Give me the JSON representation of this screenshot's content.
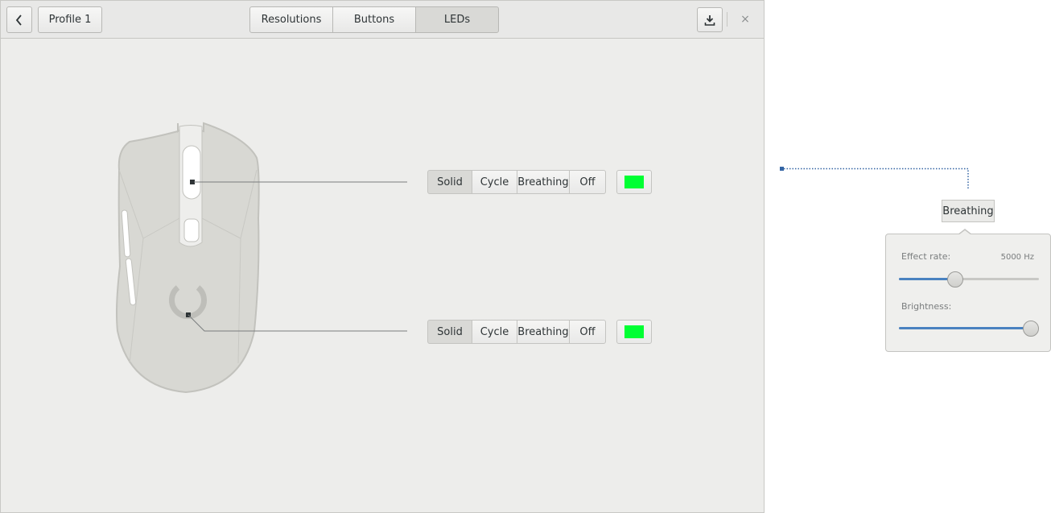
{
  "header": {
    "back_icon": "chevron-left-icon",
    "profile_label": "Profile 1",
    "tabs": [
      {
        "label": "Resolutions",
        "active": false
      },
      {
        "label": "Buttons",
        "active": false
      },
      {
        "label": "LEDs",
        "active": true
      }
    ],
    "save_icon": "download-save-icon",
    "close_label": "×"
  },
  "leds": [
    {
      "modes": [
        "Solid",
        "Cycle",
        "Breathing",
        "Off"
      ],
      "selected_mode": "Solid",
      "color": "#00ff33"
    },
    {
      "modes": [
        "Solid",
        "Cycle",
        "Breathing",
        "Off"
      ],
      "selected_mode": "Solid",
      "color": "#00ff33"
    }
  ],
  "popover": {
    "mode_label": "Breathing",
    "effect_rate_label": "Effect rate:",
    "effect_rate_value": "5000 Hz",
    "effect_rate_fraction": 0.39,
    "brightness_label": "Brightness:",
    "brightness_fraction": 1.0
  },
  "colors": {
    "accent": "#4a82c0",
    "led_green": "#00ff33"
  }
}
